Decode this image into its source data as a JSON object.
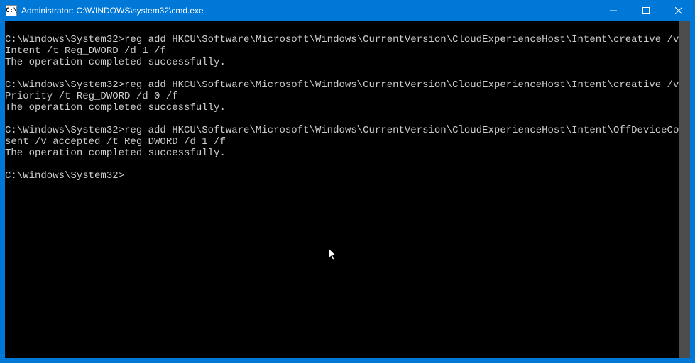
{
  "window": {
    "title": "Administrator: C:\\WINDOWS\\system32\\cmd.exe",
    "icon_label": "C:\\"
  },
  "terminal": {
    "blocks": [
      {
        "prompt": "C:\\Windows\\System32>",
        "command": "reg add HKCU\\Software\\Microsoft\\Windows\\CurrentVersion\\CloudExperienceHost\\Intent\\creative /v Intent /t Reg_DWORD /d 1 /f",
        "output": "The operation completed successfully."
      },
      {
        "prompt": "C:\\Windows\\System32>",
        "command": "reg add HKCU\\Software\\Microsoft\\Windows\\CurrentVersion\\CloudExperienceHost\\Intent\\creative /v Priority /t Reg_DWORD /d 0 /f",
        "output": "The operation completed successfully."
      },
      {
        "prompt": "C:\\Windows\\System32>",
        "command": "reg add HKCU\\Software\\Microsoft\\Windows\\CurrentVersion\\CloudExperienceHost\\Intent\\OffDeviceConsent /v accepted /t Reg_DWORD /d 1 /f",
        "output": "The operation completed successfully."
      }
    ],
    "current_prompt": "C:\\Windows\\System32>"
  }
}
